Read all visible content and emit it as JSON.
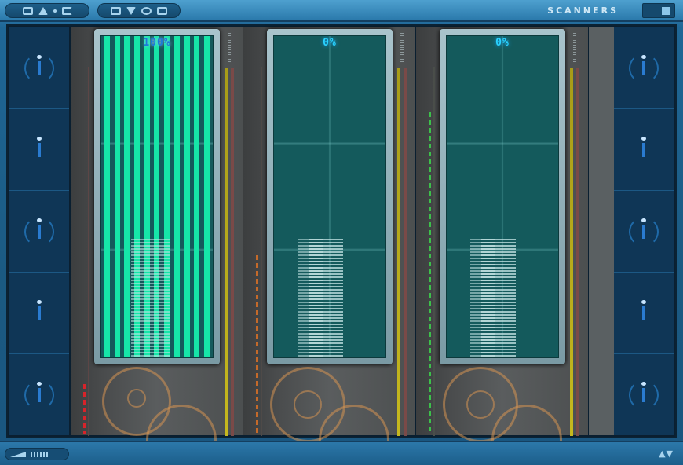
{
  "window": {
    "title": "SCANNERS"
  },
  "scanners": [
    {
      "readout": "100%",
      "fill": 1.0
    },
    {
      "readout": "0%",
      "fill": 0.0
    },
    {
      "readout": "0%",
      "fill": 0.0
    }
  ],
  "colors": {
    "bar_fill": "#16e6a8",
    "readout_blue": "#29d3ff",
    "frame": "#1b5a82"
  },
  "icons": {
    "side_slots": "info-icon",
    "top_left_group_1": [
      "triangle-icon",
      "dot-icon",
      "c-icon"
    ],
    "top_left_group_2": [
      "down-icon",
      "circle-icon",
      "house-icon"
    ]
  }
}
